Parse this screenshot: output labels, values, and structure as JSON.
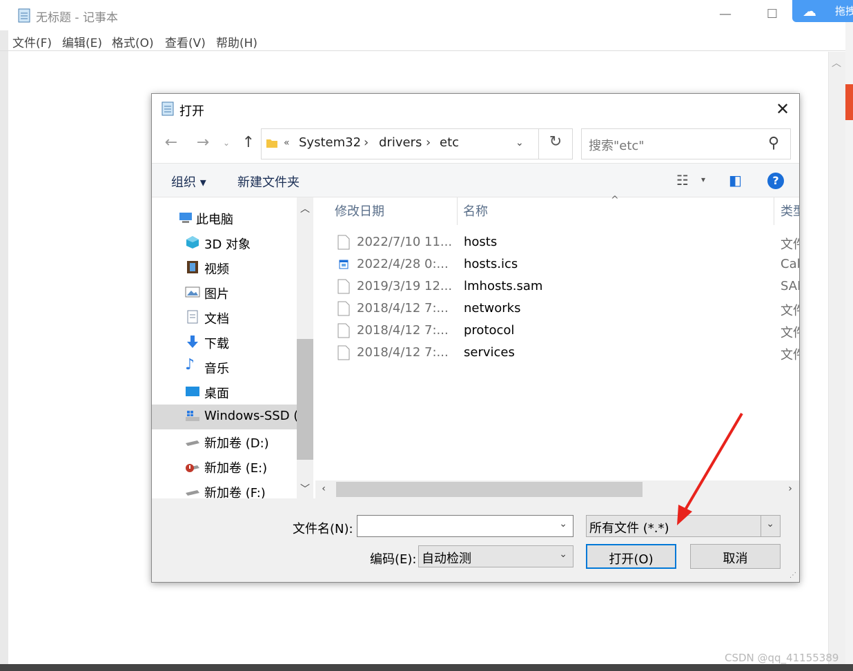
{
  "notepad": {
    "title": "无标题 - 记事本",
    "menu": [
      "文件(F)",
      "编辑(E)",
      "格式(O)",
      "查看(V)",
      "帮助(H)"
    ]
  },
  "badge": {
    "text": "拖拽"
  },
  "dialog": {
    "title": "打开",
    "address": {
      "overflow": "«",
      "segments": [
        "System32",
        "drivers",
        "etc"
      ]
    },
    "search_placeholder": "搜索\"etc\"",
    "toolbar": {
      "organize": "组织 ▾",
      "new_folder": "新建文件夹"
    },
    "nav": [
      {
        "label": "此电脑",
        "icon": "computer-icon",
        "color": "#3a8ee6"
      },
      {
        "label": "3D 对象",
        "icon": "cube-icon",
        "color": "#29a9d6"
      },
      {
        "label": "视频",
        "icon": "film-icon",
        "color": "#5b3a1e"
      },
      {
        "label": "图片",
        "icon": "picture-icon",
        "color": "#5a8fc8"
      },
      {
        "label": "文档",
        "icon": "document-icon",
        "color": "#7a8aa0"
      },
      {
        "label": "下载",
        "icon": "download-arrow-icon",
        "color": "#2d7de3"
      },
      {
        "label": "音乐",
        "icon": "music-note-icon",
        "color": "#2d7de3"
      },
      {
        "label": "桌面",
        "icon": "desktop-icon",
        "color": "#1f8fe0"
      },
      {
        "label": "Windows-SSD (",
        "icon": "windows-drive-icon",
        "color": "#2d7de3"
      },
      {
        "label": "新加卷 (D:)",
        "icon": "drive-icon",
        "color": "#999999"
      },
      {
        "label": "新加卷 (E:)",
        "icon": "drive-error-icon",
        "color": "#c0392b"
      },
      {
        "label": "新加卷 (F:)",
        "icon": "drive-icon",
        "color": "#999999"
      }
    ],
    "columns": {
      "modified": "修改日期",
      "name": "名称",
      "type": "类型"
    },
    "files": [
      {
        "date": "2022/7/10 11...",
        "name": "hosts",
        "type": "文件",
        "icon": "file-icon"
      },
      {
        "date": "2022/4/28 0:...",
        "name": "hosts.ics",
        "type": "Cal",
        "icon": "calendar-file-icon"
      },
      {
        "date": "2019/3/19 12...",
        "name": "lmhosts.sam",
        "type": "SAI",
        "icon": "file-icon"
      },
      {
        "date": "2018/4/12 7:...",
        "name": "networks",
        "type": "文件",
        "icon": "file-icon"
      },
      {
        "date": "2018/4/12 7:...",
        "name": "protocol",
        "type": "文件",
        "icon": "file-icon"
      },
      {
        "date": "2018/4/12 7:...",
        "name": "services",
        "type": "文件",
        "icon": "file-icon"
      }
    ],
    "filename_label": "文件名(N):",
    "filename_value": "",
    "filetype_value": "所有文件  (*.*)",
    "encoding_label": "编码(E):",
    "encoding_value": "自动检测",
    "open_button": "打开(O)",
    "cancel_button": "取消"
  },
  "watermark": "CSDN @qq_41155389",
  "colors": {
    "accent": "#0078d7",
    "annotation_arrow": "#e8231c"
  }
}
